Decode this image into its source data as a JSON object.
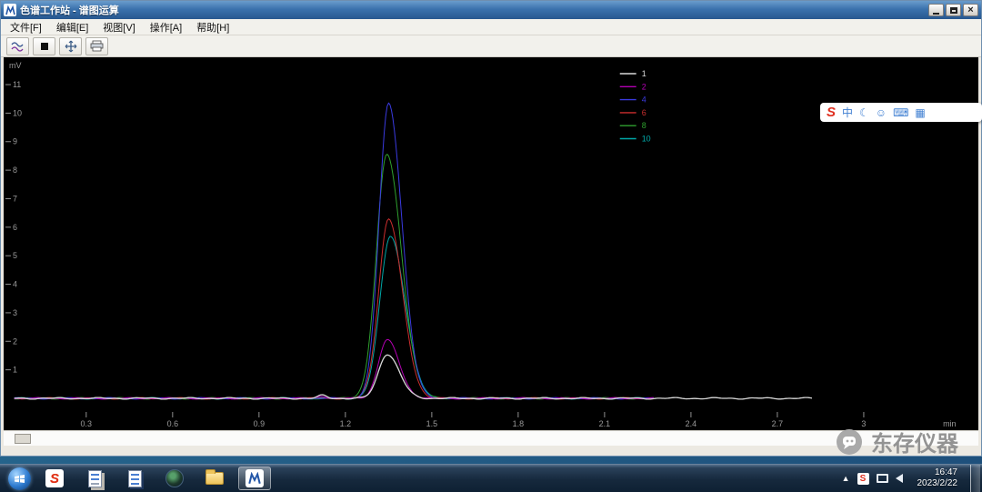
{
  "window": {
    "title": "色谱工作站 - 谱图运算"
  },
  "menu": {
    "items": [
      "文件[F]",
      "编辑[E]",
      "视图[V]",
      "操作[A]",
      "帮助[H]"
    ],
    "keys": [
      "file",
      "edit",
      "view",
      "action",
      "help"
    ]
  },
  "toolbar": {
    "buttons": [
      "curves-icon",
      "stop-icon",
      "zoom-extents-icon",
      "print-icon"
    ]
  },
  "chart_data": {
    "type": "line",
    "title": "",
    "xlabel": "min",
    "ylabel": "mV",
    "xlim": [
      0,
      3.1
    ],
    "ylim": [
      -0.5,
      11.5
    ],
    "x_ticks": [
      "0.3",
      "0.6",
      "0.9",
      "1.2",
      "1.5",
      "1.8",
      "2.1",
      "2.4",
      "2.7",
      "3"
    ],
    "x_tick_values": [
      0.3,
      0.6,
      0.9,
      1.2,
      1.5,
      1.8,
      2.1,
      2.4,
      2.7,
      3.0
    ],
    "y_ticks": [
      1,
      2,
      3,
      4,
      5,
      6,
      7,
      8,
      9,
      10,
      11
    ],
    "grid": false,
    "legend_position": "top-center-right",
    "background": "#000000",
    "baseline_mv": 0,
    "peak_retention_min": 1.35,
    "series": [
      {
        "name": "1",
        "color": "#d9d9d9",
        "peak": {
          "center": 1.345,
          "height": 1.55,
          "sigma": 0.03
        },
        "bumps": [
          {
            "c": 1.12,
            "h": 0.1,
            "s": 0.015
          }
        ],
        "x_end": 2.82
      },
      {
        "name": "2",
        "color": "#b400b4",
        "peak": {
          "center": 1.345,
          "height": 2.05,
          "sigma": 0.03
        },
        "bumps": [
          {
            "c": 1.12,
            "h": 0.08,
            "s": 0.015
          }
        ],
        "x_end": 2.27
      },
      {
        "name": "4",
        "color": "#3a3ae0",
        "peak": {
          "center": 1.35,
          "height": 10.35,
          "sigma": 0.033
        },
        "bumps": [],
        "x_end": 2.27
      },
      {
        "name": "6",
        "color": "#cc2e2e",
        "peak": {
          "center": 1.35,
          "height": 6.3,
          "sigma": 0.034
        },
        "bumps": [],
        "x_end": 2.27
      },
      {
        "name": "8",
        "color": "#2fa02f",
        "peak": {
          "center": 1.344,
          "height": 8.55,
          "sigma": 0.036
        },
        "bumps": [],
        "x_end": 2.27
      },
      {
        "name": "10",
        "color": "#00a8a8",
        "peak": {
          "center": 1.356,
          "height": 5.7,
          "sigma": 0.036
        },
        "bumps": [],
        "x_end": 2.27
      }
    ]
  },
  "ime": {
    "items": [
      {
        "name": "sogou-logo-icon",
        "glyph": "S"
      },
      {
        "name": "chinese-mode-icon",
        "glyph": "中"
      },
      {
        "name": "moon-mode-icon",
        "glyph": "☾"
      },
      {
        "name": "emoji-icon",
        "glyph": "☺"
      },
      {
        "name": "keyboard-icon",
        "glyph": "⌨"
      },
      {
        "name": "toolbox-icon",
        "glyph": "▦"
      }
    ]
  },
  "watermark": {
    "text": "东存仪器"
  },
  "taskbar": {
    "icons": [
      "start-orb",
      "sogou",
      "documents",
      "editor-page",
      "browser-globe",
      "folder",
      "chromatography-app"
    ],
    "active_icon": "chromatography-app",
    "tray": [
      "hidden-icons-chevron",
      "sogou-tray",
      "display",
      "volume"
    ],
    "clock": {
      "time": "16:47",
      "date": "2023/2/22"
    }
  }
}
